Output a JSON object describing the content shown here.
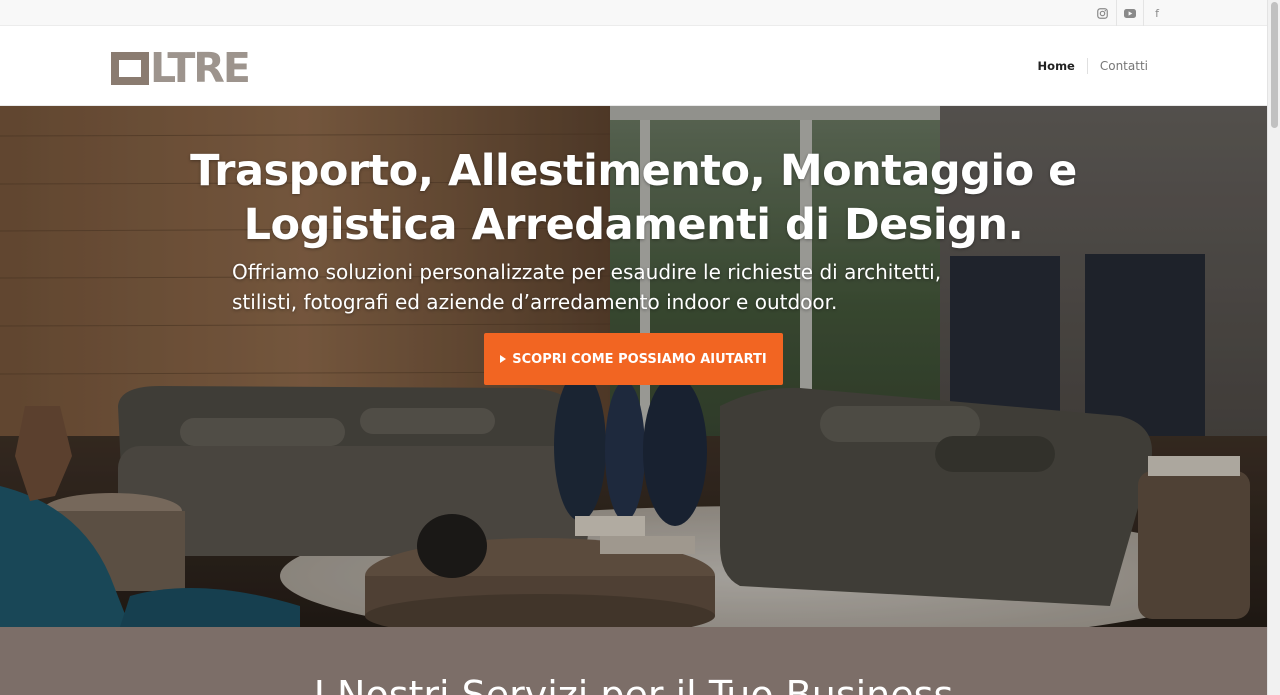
{
  "social": {
    "items": [
      {
        "name": "instagram-icon"
      },
      {
        "name": "youtube-icon"
      },
      {
        "name": "facebook-icon",
        "glyph": "f"
      }
    ]
  },
  "header": {
    "logo_text": "LTRE",
    "nav": [
      {
        "label": "Home",
        "active": true
      },
      {
        "label": "Contatti",
        "active": false
      }
    ]
  },
  "hero": {
    "title_line1": "Trasporto, Allestimento, Montaggio e",
    "title_line2": "Logistica Arredamenti di Design.",
    "subtitle_line1": "Offriamo soluzioni personalizzate per esaudire le richieste di architetti,",
    "subtitle_line2": "stilisti, fotografi ed aziende d’arredamento indoor e outdoor.",
    "cta_label": "SCOPRI COME POSSIAMO AIUTARTI"
  },
  "services": {
    "heading": "I Nostri Servizi per il Tuo Business"
  },
  "colors": {
    "accent": "#f26522",
    "brand_brown": "#8a7b70",
    "section_bg": "#7c6e68"
  }
}
